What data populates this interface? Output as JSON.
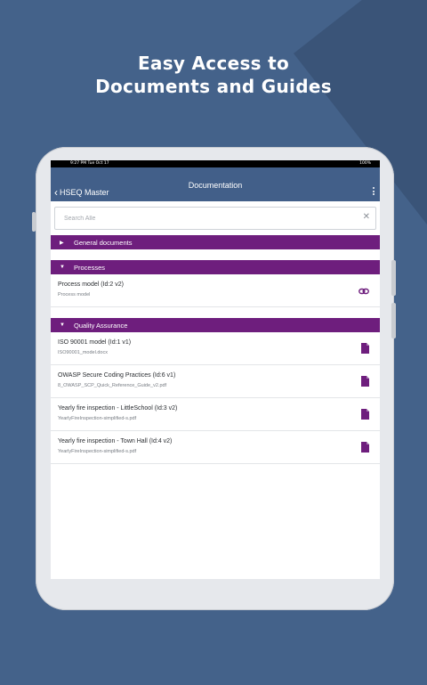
{
  "headline": {
    "line1": "Easy Access to",
    "line2": "Documents and Guides"
  },
  "status_bar": {
    "time": "9:27 PM   Tue Oct 17",
    "battery": "100%"
  },
  "nav": {
    "back_label": "HSEQ Master",
    "title": "Documentation"
  },
  "search": {
    "placeholder": "Search Alle"
  },
  "sections": [
    {
      "title": "General documents",
      "expanded": false,
      "items": []
    },
    {
      "title": "Processes",
      "expanded": true,
      "items": [
        {
          "title": "Process model (Id:2 v2)",
          "subtitle": "Process model",
          "icon": "link-icon"
        }
      ]
    },
    {
      "title": "Quality Assurance",
      "expanded": true,
      "items": [
        {
          "title": "ISO 90001 model (Id:1 v1)",
          "subtitle": "ISO90001_model.docx",
          "icon": "file-icon"
        },
        {
          "title": "OWASP Secure Coding Practices (Id:6 v1)",
          "subtitle": "8_OWASP_SCP_Quick_Reference_Guide_v2.pdf",
          "icon": "file-icon"
        },
        {
          "title": "Yearly fire inspection - LittleSchool (Id:3 v2)",
          "subtitle": "YearlyFireInspection-simplified-s.pdf",
          "icon": "file-icon"
        },
        {
          "title": "Yearly fire inspection - Town Hall (Id:4 v2)",
          "subtitle": "YearlyFireInspection-simplified-s.pdf",
          "icon": "file-icon"
        }
      ]
    }
  ],
  "colors": {
    "background": "#44628a",
    "navbar": "#425f89",
    "section": "#6e1e7d",
    "icon": "#6e1e7d"
  }
}
